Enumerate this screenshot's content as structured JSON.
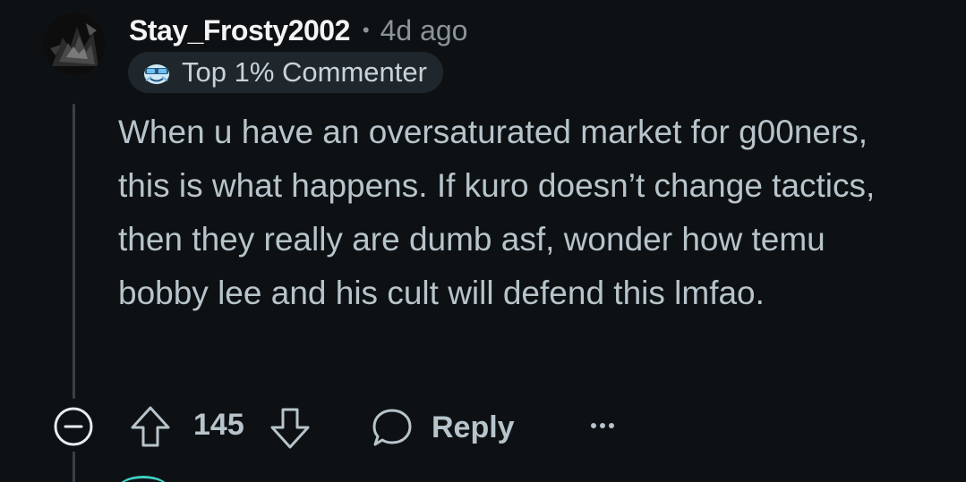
{
  "comment": {
    "author": "Stay_Frosty2002",
    "separator": "•",
    "age": "4d ago",
    "flair": {
      "icon": "sunglasses-snoo-icon",
      "label": "Top 1% Commenter"
    },
    "body": "When u have an oversaturated market for g00ners, this is what happens. If kuro doesn’t change tactics, then they really are dumb asf, wonder how temu bobby lee and his cult will defend this lmfao.",
    "score": "145",
    "reply_label": "Reply"
  },
  "icons": {
    "collapse": "minus-circle-icon",
    "upvote": "arrow-up-icon",
    "downvote": "arrow-down-icon",
    "reply": "speech-bubble-icon",
    "more": "ellipsis-icon"
  },
  "colors": {
    "background": "#0e1113",
    "username": "#f2f4f5",
    "meta": "#8a949a",
    "body_text": "#b7c4cb",
    "flair_bg": "#1f272d",
    "thread_line": "#3a4147"
  }
}
